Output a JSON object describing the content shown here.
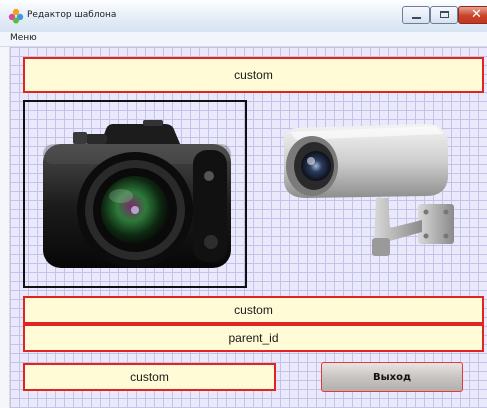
{
  "window": {
    "title": "Редактор шаблона",
    "close_glyph": "✕"
  },
  "menu": {
    "items": [
      {
        "label": "Меню"
      }
    ]
  },
  "fields": {
    "top": "custom",
    "middle_custom": "custom",
    "parent_id": "parent_id",
    "bottom_custom": "custom"
  },
  "buttons": {
    "exit_label": "Выход"
  },
  "images": {
    "photo_camera": "photo-camera-icon",
    "security_camera": "security-camera-icon"
  },
  "colors": {
    "field_bg": "#fffbd6",
    "field_border": "#e02424",
    "grid_bg": "#e9e9fb",
    "grid_line": "#c3c3ea"
  }
}
